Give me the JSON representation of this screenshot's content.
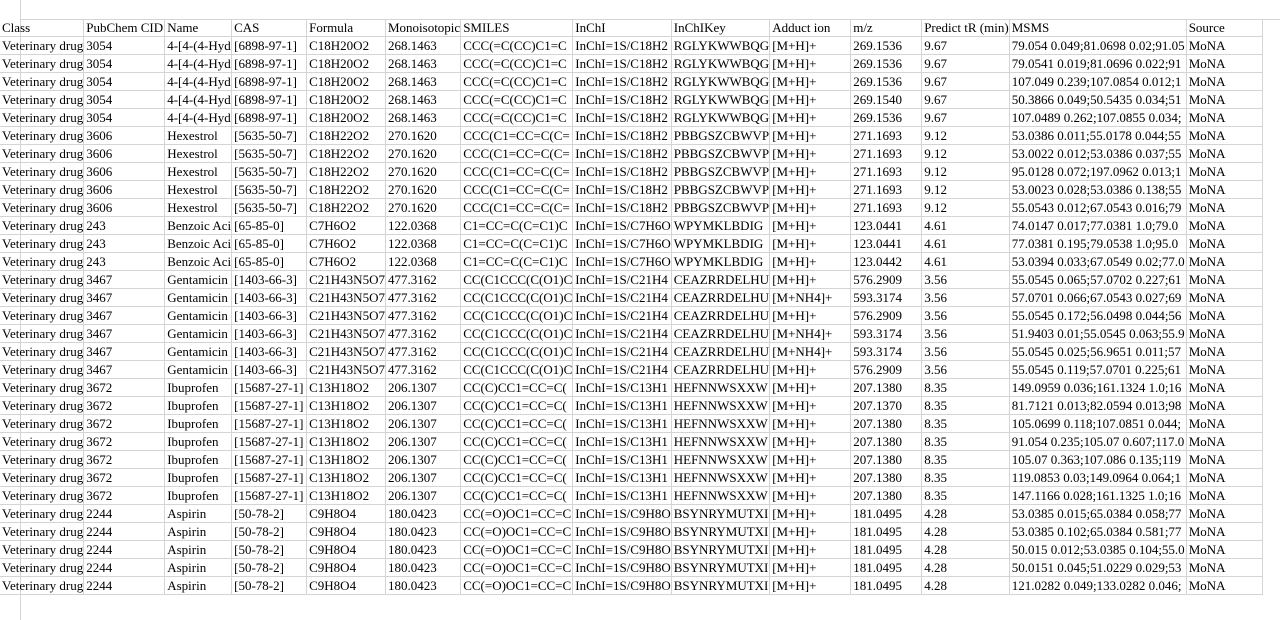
{
  "headers": [
    "Class",
    "PubChem CID",
    "Name",
    "CAS",
    "Formula",
    "Monoisotopic",
    "SMILES",
    "InChI",
    "InChIKey",
    "Adduct ion",
    "m/z",
    "Predict tR (min)",
    "MSMS",
    "Source"
  ],
  "rows": [
    [
      "Veterinary drug",
      "3054",
      "4-[4-(4-Hyd",
      "[6898-97-1]",
      "C18H20O2",
      "268.1463",
      "CCC(=C(CC)C1=C",
      "InChI=1S/C18H2",
      "RGLYKWWBQG",
      "[M+H]+",
      "269.1536",
      "9.67",
      "79.054 0.049;81.0698 0.02;91.05",
      "MoNA"
    ],
    [
      "Veterinary drug",
      "3054",
      "4-[4-(4-Hyd",
      "[6898-97-1]",
      "C18H20O2",
      "268.1463",
      "CCC(=C(CC)C1=C",
      "InChI=1S/C18H2",
      "RGLYKWWBQG",
      "[M+H]+",
      "269.1536",
      "9.67",
      "79.0541 0.019;81.0696 0.022;91",
      "MoNA"
    ],
    [
      "Veterinary drug",
      "3054",
      "4-[4-(4-Hyd",
      "[6898-97-1]",
      "C18H20O2",
      "268.1463",
      "CCC(=C(CC)C1=C",
      "InChI=1S/C18H2",
      "RGLYKWWBQG",
      "[M+H]+",
      "269.1536",
      "9.67",
      "107.049 0.239;107.0854 0.012;1",
      "MoNA"
    ],
    [
      "Veterinary drug",
      "3054",
      "4-[4-(4-Hyd",
      "[6898-97-1]",
      "C18H20O2",
      "268.1463",
      "CCC(=C(CC)C1=C",
      "InChI=1S/C18H2",
      "RGLYKWWBQG",
      "[M+H]+",
      "269.1540",
      "9.67",
      "50.3866 0.049;50.5435 0.034;51",
      "MoNA"
    ],
    [
      "Veterinary drug",
      "3054",
      "4-[4-(4-Hyd",
      "[6898-97-1]",
      "C18H20O2",
      "268.1463",
      "CCC(=C(CC)C1=C",
      "InChI=1S/C18H2",
      "RGLYKWWBQG",
      "[M+H]+",
      "269.1536",
      "9.67",
      "107.0489 0.262;107.0855 0.034;",
      "MoNA"
    ],
    [
      "Veterinary drug",
      "3606",
      "Hexestrol",
      "[5635-50-7]",
      "C18H22O2",
      "270.1620",
      "CCC(C1=CC=C(C=",
      "InChI=1S/C18H2",
      "PBBGSZCBWVP",
      "[M+H]+",
      "271.1693",
      "9.12",
      "53.0386 0.011;55.0178 0.044;55",
      "MoNA"
    ],
    [
      "Veterinary drug",
      "3606",
      "Hexestrol",
      "[5635-50-7]",
      "C18H22O2",
      "270.1620",
      "CCC(C1=CC=C(C=",
      "InChI=1S/C18H2",
      "PBBGSZCBWVP",
      "[M+H]+",
      "271.1693",
      "9.12",
      "53.0022 0.012;53.0386 0.037;55",
      "MoNA"
    ],
    [
      "Veterinary drug",
      "3606",
      "Hexestrol",
      "[5635-50-7]",
      "C18H22O2",
      "270.1620",
      "CCC(C1=CC=C(C=",
      "InChI=1S/C18H2",
      "PBBGSZCBWVP",
      "[M+H]+",
      "271.1693",
      "9.12",
      "95.0128 0.072;197.0962 0.013;1",
      "MoNA"
    ],
    [
      "Veterinary drug",
      "3606",
      "Hexestrol",
      "[5635-50-7]",
      "C18H22O2",
      "270.1620",
      "CCC(C1=CC=C(C=",
      "InChI=1S/C18H2",
      "PBBGSZCBWVP",
      "[M+H]+",
      "271.1693",
      "9.12",
      "53.0023 0.028;53.0386 0.138;55",
      "MoNA"
    ],
    [
      "Veterinary drug",
      "3606",
      "Hexestrol",
      "[5635-50-7]",
      "C18H22O2",
      "270.1620",
      "CCC(C1=CC=C(C=",
      "InChI=1S/C18H2",
      "PBBGSZCBWVP",
      "[M+H]+",
      "271.1693",
      "9.12",
      "55.0543 0.012;67.0543 0.016;79",
      "MoNA"
    ],
    [
      "Veterinary drug",
      "243",
      "Benzoic Aci",
      "[65-85-0]",
      "C7H6O2",
      "122.0368",
      "C1=CC=C(C=C1)C",
      "InChI=1S/C7H6O",
      "WPYMKLBDIG",
      "[M+H]+",
      "123.0441",
      "4.61",
      "74.0147 0.017;77.0381 1.0;79.0",
      "MoNA"
    ],
    [
      "Veterinary drug",
      "243",
      "Benzoic Aci",
      "[65-85-0]",
      "C7H6O2",
      "122.0368",
      "C1=CC=C(C=C1)C",
      "InChI=1S/C7H6O",
      "WPYMKLBDIG",
      "[M+H]+",
      "123.0441",
      "4.61",
      "77.0381 0.195;79.0538 1.0;95.0",
      "MoNA"
    ],
    [
      "Veterinary drug",
      "243",
      "Benzoic Aci",
      "[65-85-0]",
      "C7H6O2",
      "122.0368",
      "C1=CC=C(C=C1)C",
      "InChI=1S/C7H6O",
      "WPYMKLBDIG",
      "[M+H]+",
      "123.0442",
      "4.61",
      "53.0394 0.033;67.0549 0.02;77.0",
      "MoNA"
    ],
    [
      "Veterinary drug",
      "3467",
      "Gentamicin",
      "[1403-66-3]",
      "C21H43N5O7",
      "477.3162",
      "CC(C1CCC(C(O1)C",
      "InChI=1S/C21H4",
      "CEAZRRDELHU",
      "[M+H]+",
      "576.2909",
      "3.56",
      "55.0545 0.065;57.0702 0.227;61",
      "MoNA"
    ],
    [
      "Veterinary drug",
      "3467",
      "Gentamicin",
      "[1403-66-3]",
      "C21H43N5O7",
      "477.3162",
      "CC(C1CCC(C(O1)C",
      "InChI=1S/C21H4",
      "CEAZRRDELHU",
      "[M+NH4]+",
      "593.3174",
      "3.56",
      "57.0701 0.066;67.0543 0.027;69",
      "MoNA"
    ],
    [
      "Veterinary drug",
      "3467",
      "Gentamicin",
      "[1403-66-3]",
      "C21H43N5O7",
      "477.3162",
      "CC(C1CCC(C(O1)C",
      "InChI=1S/C21H4",
      "CEAZRRDELHU",
      "[M+H]+",
      "576.2909",
      "3.56",
      "55.0545 0.172;56.0498 0.044;56",
      "MoNA"
    ],
    [
      "Veterinary drug",
      "3467",
      "Gentamicin",
      "[1403-66-3]",
      "C21H43N5O7",
      "477.3162",
      "CC(C1CCC(C(O1)C",
      "InChI=1S/C21H4",
      "CEAZRRDELHU",
      "[M+NH4]+",
      "593.3174",
      "3.56",
      "51.9403 0.01;55.0545 0.063;55.9",
      "MoNA"
    ],
    [
      "Veterinary drug",
      "3467",
      "Gentamicin",
      "[1403-66-3]",
      "C21H43N5O7",
      "477.3162",
      "CC(C1CCC(C(O1)C",
      "InChI=1S/C21H4",
      "CEAZRRDELHU",
      "[M+NH4]+",
      "593.3174",
      "3.56",
      "55.0545 0.025;56.9651 0.011;57",
      "MoNA"
    ],
    [
      "Veterinary drug",
      "3467",
      "Gentamicin",
      "[1403-66-3]",
      "C21H43N5O7",
      "477.3162",
      "CC(C1CCC(C(O1)C",
      "InChI=1S/C21H4",
      "CEAZRRDELHU",
      "[M+H]+",
      "576.2909",
      "3.56",
      "55.0545 0.119;57.0701 0.225;61",
      "MoNA"
    ],
    [
      "Veterinary drug",
      "3672",
      "Ibuprofen",
      "[15687-27-1]",
      "C13H18O2",
      "206.1307",
      "CC(C)CC1=CC=C(",
      "InChI=1S/C13H1",
      "HEFNNWSXXW",
      "[M+H]+",
      "207.1380",
      "8.35",
      "149.0959 0.036;161.1324 1.0;16",
      "MoNA"
    ],
    [
      "Veterinary drug",
      "3672",
      "Ibuprofen",
      "[15687-27-1]",
      "C13H18O2",
      "206.1307",
      "CC(C)CC1=CC=C(",
      "InChI=1S/C13H1",
      "HEFNNWSXXW",
      "[M+H]+",
      "207.1370",
      "8.35",
      "81.7121 0.013;82.0594 0.013;98",
      "MoNA"
    ],
    [
      "Veterinary drug",
      "3672",
      "Ibuprofen",
      "[15687-27-1]",
      "C13H18O2",
      "206.1307",
      "CC(C)CC1=CC=C(",
      "InChI=1S/C13H1",
      "HEFNNWSXXW",
      "[M+H]+",
      "207.1380",
      "8.35",
      "105.0699 0.118;107.0851 0.044;",
      "MoNA"
    ],
    [
      "Veterinary drug",
      "3672",
      "Ibuprofen",
      "[15687-27-1]",
      "C13H18O2",
      "206.1307",
      "CC(C)CC1=CC=C(",
      "InChI=1S/C13H1",
      "HEFNNWSXXW",
      "[M+H]+",
      "207.1380",
      "8.35",
      "91.054 0.235;105.07 0.607;117.0",
      "MoNA"
    ],
    [
      "Veterinary drug",
      "3672",
      "Ibuprofen",
      "[15687-27-1]",
      "C13H18O2",
      "206.1307",
      "CC(C)CC1=CC=C(",
      "InChI=1S/C13H1",
      "HEFNNWSXXW",
      "[M+H]+",
      "207.1380",
      "8.35",
      "105.07 0.363;107.086 0.135;119",
      "MoNA"
    ],
    [
      "Veterinary drug",
      "3672",
      "Ibuprofen",
      "[15687-27-1]",
      "C13H18O2",
      "206.1307",
      "CC(C)CC1=CC=C(",
      "InChI=1S/C13H1",
      "HEFNNWSXXW",
      "[M+H]+",
      "207.1380",
      "8.35",
      "119.0853 0.03;149.0964 0.064;1",
      "MoNA"
    ],
    [
      "Veterinary drug",
      "3672",
      "Ibuprofen",
      "[15687-27-1]",
      "C13H18O2",
      "206.1307",
      "CC(C)CC1=CC=C(",
      "InChI=1S/C13H1",
      "HEFNNWSXXW",
      "[M+H]+",
      "207.1380",
      "8.35",
      "147.1166 0.028;161.1325 1.0;16",
      "MoNA"
    ],
    [
      "Veterinary drug",
      "2244",
      "Aspirin",
      "[50-78-2]",
      "C9H8O4",
      "180.0423",
      "CC(=O)OC1=CC=C",
      "InChI=1S/C9H8O",
      "BSYNRYMUTXI",
      "[M+H]+",
      "181.0495",
      "4.28",
      "53.0385 0.015;65.0384 0.058;77",
      "MoNA"
    ],
    [
      "Veterinary drug",
      "2244",
      "Aspirin",
      "[50-78-2]",
      "C9H8O4",
      "180.0423",
      "CC(=O)OC1=CC=C",
      "InChI=1S/C9H8O",
      "BSYNRYMUTXI",
      "[M+H]+",
      "181.0495",
      "4.28",
      "53.0385 0.102;65.0384 0.581;77",
      "MoNA"
    ],
    [
      "Veterinary drug",
      "2244",
      "Aspirin",
      "[50-78-2]",
      "C9H8O4",
      "180.0423",
      "CC(=O)OC1=CC=C",
      "InChI=1S/C9H8O",
      "BSYNRYMUTXI",
      "[M+H]+",
      "181.0495",
      "4.28",
      "50.015 0.012;53.0385 0.104;55.0",
      "MoNA"
    ],
    [
      "Veterinary drug",
      "2244",
      "Aspirin",
      "[50-78-2]",
      "C9H8O4",
      "180.0423",
      "CC(=O)OC1=CC=C",
      "InChI=1S/C9H8O",
      "BSYNRYMUTXI",
      "[M+H]+",
      "181.0495",
      "4.28",
      "50.0151 0.045;51.0229 0.029;53",
      "MoNA"
    ],
    [
      "Veterinary drug",
      "2244",
      "Aspirin",
      "[50-78-2]",
      "C9H8O4",
      "180.0423",
      "CC(=O)OC1=CC=C",
      "InChI=1S/C9H8O",
      "BSYNRYMUTXI",
      "[M+H]+",
      "181.0495",
      "4.28",
      "121.0282 0.049;133.0282 0.046;",
      "MoNA"
    ]
  ]
}
